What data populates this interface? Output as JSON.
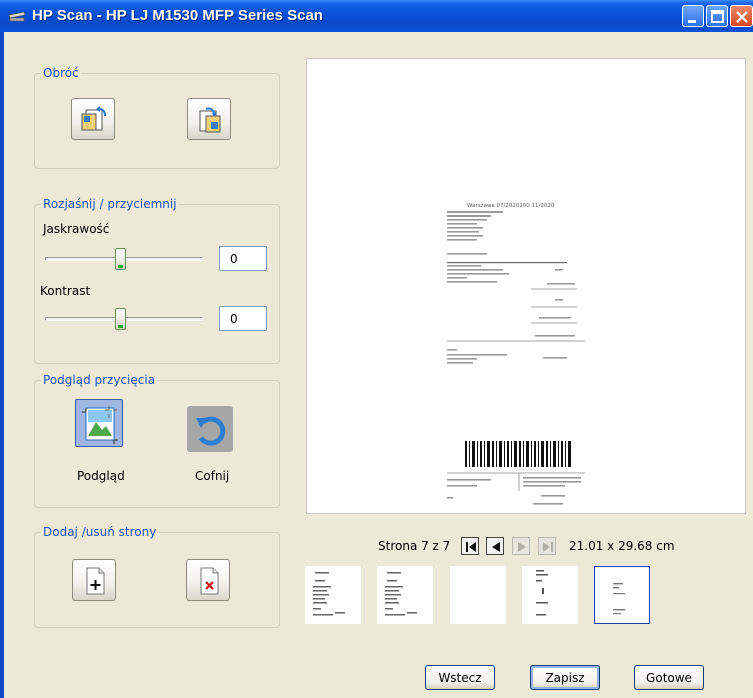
{
  "window": {
    "title": "HP Scan - HP LJ M1530 MFP Series Scan",
    "title_color": "#FFFFFF",
    "accent_color": "#0A50D8"
  },
  "rotate": {
    "legend": "Obróć",
    "left_icon": "rotate-left-icon",
    "right_icon": "rotate-right-icon"
  },
  "brightness": {
    "legend": "Rozjaśnij / przyciemnij",
    "brightness_label": "Jaskrawość",
    "brightness_value": "0",
    "brightness_level": 0.5,
    "contrast_label": "Kontrast",
    "contrast_value": "0",
    "contrast_level": 0.5
  },
  "crop": {
    "legend": "Podgląd przycięcia",
    "preview_label": "Podgląd",
    "undo_label": "Cofnij"
  },
  "pages": {
    "legend": "Dodaj /usuń strony",
    "add_icon": "add-page-icon",
    "remove_icon": "remove-page-icon"
  },
  "navigation": {
    "page_text": "Strona 7 z 7",
    "size_text": "21.01 x 29.68 cm"
  },
  "preview_doc": {
    "header_line": "Warszawa 07/2020200 11/2020"
  },
  "thumbnails": [
    {
      "name": "page-thumbnail-1",
      "selected": false
    },
    {
      "name": "page-thumbnail-2",
      "selected": false
    },
    {
      "name": "page-thumbnail-3",
      "selected": false
    },
    {
      "name": "page-thumbnail-4",
      "selected": false
    },
    {
      "name": "page-thumbnail-5",
      "selected": true
    }
  ],
  "buttons": {
    "back": "Wstecz",
    "save": "Zapisz",
    "done": "Gotowe"
  }
}
